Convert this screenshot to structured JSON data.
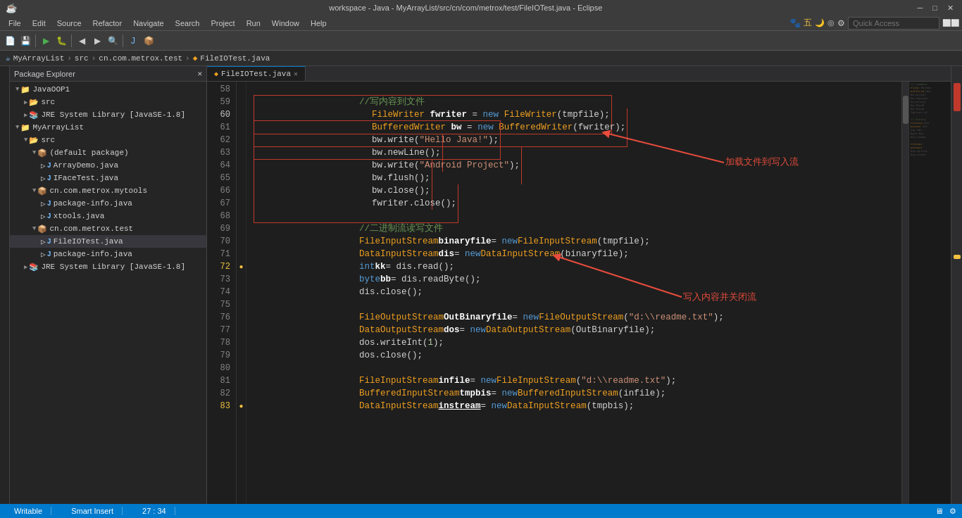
{
  "titleBar": {
    "title": "workspace - Java - MyArrayList/src/cn/com/metrox/test/FileIOTest.java - Eclipse",
    "minimize": "─",
    "maximize": "□",
    "close": "✕"
  },
  "menuBar": {
    "items": [
      "File",
      "Edit",
      "Source",
      "Refactor",
      "Navigate",
      "Search",
      "Project",
      "Run",
      "Window",
      "Help"
    ]
  },
  "breadcrumb": {
    "items": [
      "MyArrayList",
      "src",
      "cn.com.metrox.test",
      "FileIOTest.java"
    ]
  },
  "sidebar": {
    "title": "Package Explorer",
    "tree": [
      {
        "indent": 0,
        "icon": "▼",
        "label": "JavaOOP1",
        "type": "project"
      },
      {
        "indent": 1,
        "icon": "▶",
        "label": "src",
        "type": "folder"
      },
      {
        "indent": 1,
        "icon": "▶",
        "label": "JRE System Library [JavaSE-1.8]",
        "type": "lib"
      },
      {
        "indent": 0,
        "icon": "▼",
        "label": "MyArrayList",
        "type": "project"
      },
      {
        "indent": 1,
        "icon": "▼",
        "label": "src",
        "type": "folder"
      },
      {
        "indent": 2,
        "icon": "▼",
        "label": "(default package)",
        "type": "package"
      },
      {
        "indent": 3,
        "icon": "J",
        "label": "ArrayDemo.java",
        "type": "java"
      },
      {
        "indent": 3,
        "icon": "J",
        "label": "IFaceTest.java",
        "type": "java"
      },
      {
        "indent": 2,
        "icon": "▼",
        "label": "cn.com.metrox.mytools",
        "type": "package"
      },
      {
        "indent": 3,
        "icon": "J",
        "label": "package-info.java",
        "type": "java"
      },
      {
        "indent": 3,
        "icon": "J",
        "label": "xtools.java",
        "type": "java"
      },
      {
        "indent": 2,
        "icon": "▼",
        "label": "cn.com.metrox.test",
        "type": "package"
      },
      {
        "indent": 3,
        "icon": "J",
        "label": "FileIOTest.java",
        "type": "java",
        "selected": true
      },
      {
        "indent": 3,
        "icon": "J",
        "label": "package-info.java",
        "type": "java"
      },
      {
        "indent": 1,
        "icon": "▶",
        "label": "JRE System Library [JavaSE-1.8]",
        "type": "lib"
      }
    ]
  },
  "editor": {
    "tab": "FileIOTest.java",
    "lines": [
      {
        "num": 58,
        "content": "",
        "tokens": []
      },
      {
        "num": 59,
        "content": "\t\t//写内容到文件",
        "comment": true
      },
      {
        "num": 60,
        "content": "\t\tFileWriter fwriter = new FileWriter(tmpfile);",
        "has_red_box": true
      },
      {
        "num": 61,
        "content": "\t\tBufferedWriter bw = new BufferedWriter(fwriter);",
        "has_red_box": true
      },
      {
        "num": 62,
        "content": "\t\tbw.write(\"Hello Java!\");",
        "has_red_box2": true
      },
      {
        "num": 63,
        "content": "\t\tbw.newLine();",
        "has_red_box2": true
      },
      {
        "num": 64,
        "content": "\t\tbw.write(\"Android Project\");",
        "has_red_box2": true
      },
      {
        "num": 65,
        "content": "\t\tbw.flush();",
        "has_red_box2": true
      },
      {
        "num": 66,
        "content": "\t\tbw.close();",
        "has_red_box2": true
      },
      {
        "num": 67,
        "content": "\t\tfwriter.close();",
        "has_red_box2": true
      },
      {
        "num": 68,
        "content": "",
        "tokens": []
      },
      {
        "num": 69,
        "content": "\t\t//二进制流读写文件",
        "comment": true
      },
      {
        "num": 70,
        "content": "\t\tFileInputStream binaryfile = new FileInputStream(tmpfile);"
      },
      {
        "num": 71,
        "content": "\t\tDataInputStream dis = new DataInputStream(binaryfile);"
      },
      {
        "num": 72,
        "content": "\t\tint kk = dis.read();",
        "marker": "●"
      },
      {
        "num": 73,
        "content": "\t\tbyte bb = dis.readByte();"
      },
      {
        "num": 74,
        "content": "\t\tdis.close();"
      },
      {
        "num": 75,
        "content": "",
        "tokens": []
      },
      {
        "num": 76,
        "content": "\t\tFileOutputStream OutBinaryfile = new FileOutputStream(\"d:\\\\readme.txt\");"
      },
      {
        "num": 77,
        "content": "\t\tDataOutputStream dos = new DataOutputStream(OutBinaryfile);"
      },
      {
        "num": 78,
        "content": "\t\tdos.writeInt(1);"
      },
      {
        "num": 79,
        "content": "\t\tdos.close();"
      },
      {
        "num": 80,
        "content": "",
        "tokens": []
      },
      {
        "num": 81,
        "content": "\t\tFileInputStream infile = new FileInputStream(\"d:\\\\readme.txt\");"
      },
      {
        "num": 82,
        "content": "\t\tBufferedInputStream tmpbis = new BufferedInputStream(infile);"
      },
      {
        "num": 83,
        "content": "\t\tDataInputStream instream = new DataInputStream(tmpbis);",
        "marker": "●"
      }
    ],
    "annotations": {
      "arrow1_label": "加载文件到写入流",
      "arrow2_label": "写入内容并关闭流"
    }
  },
  "statusBar": {
    "writable": "Writable",
    "insert": "Smart Insert",
    "position": "27 : 34"
  }
}
